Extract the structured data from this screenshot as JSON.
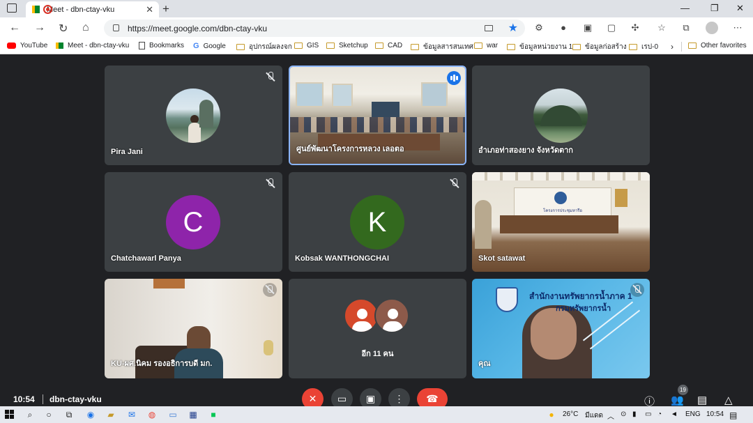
{
  "browser": {
    "tab_title": "Meet - dbn-ctay-vku",
    "url": "https://meet.google.com/dbn-ctay-vku",
    "bookmarks": [
      "YouTube",
      "Meet - dbn-ctay-vku",
      "Bookmarks",
      "Google",
      "อุปกรณ์ผลงจก",
      "GIS",
      "Sketchup",
      "CAD",
      "ข้อมูลสารสนเทศ",
      "war",
      "ข้อมูลหน่วยงาน 1",
      "ข้อมูลก่อสร้าง",
      "เรป-0"
    ],
    "other_favorites": "Other favorites"
  },
  "participants": [
    {
      "name": "Pira Jani",
      "type": "photo",
      "muted": true
    },
    {
      "name": "ศูนย์พัฒนาโครงการหลวง เลอตอ",
      "type": "video",
      "speaking": true
    },
    {
      "name": "อำเภอท่าสองยาง จังหวัดตาก",
      "type": "photo"
    },
    {
      "name": "Chatchawarl Panya",
      "initial": "C",
      "color": "#8e24aa",
      "muted": true
    },
    {
      "name": "Kobsak WANTHONGCHAI",
      "initial": "K",
      "color": "#33691e",
      "muted": true
    },
    {
      "name": "Skot satawat",
      "type": "video"
    },
    {
      "name": "KU-ผศ.นิคม รองอธิการบดี มก.",
      "type": "video",
      "muted": true
    },
    {
      "name": "คุณ",
      "type": "video",
      "muted": true,
      "banner": "สำนักงานทรัพยากรน้ำภาค 1",
      "banner2": "กรมทรัพยากรน้ำ"
    }
  ],
  "others_label": "อีก 11 คน",
  "room_sign": "โครงการประชุมหารือ",
  "meeting": {
    "time": "10:54",
    "code": "dbn-ctay-vku",
    "participant_count": "19"
  },
  "taskbar": {
    "temp": "26°C",
    "weather": "มีแดด",
    "lang": "ENG",
    "time": "10:54"
  },
  "colors": {
    "accent": "#1a73e8",
    "hangup": "#ea4335",
    "tile": "#3c4043"
  }
}
